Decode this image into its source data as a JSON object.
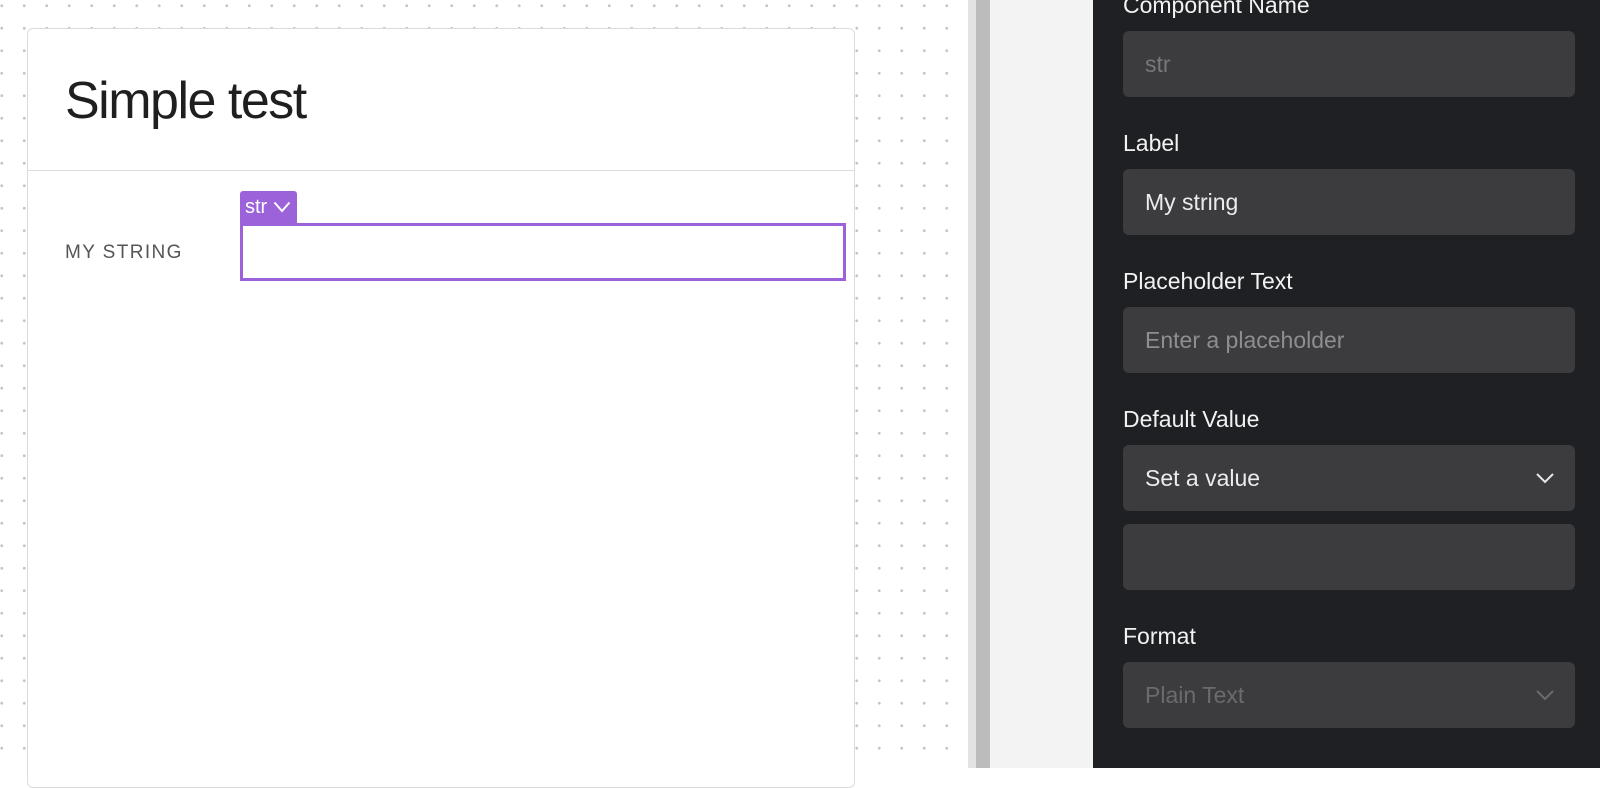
{
  "form": {
    "title": "Simple test",
    "field": {
      "label": "MY STRING",
      "tag": "str",
      "value": ""
    }
  },
  "panel": {
    "component_name": {
      "label": "Component Name",
      "value": "str"
    },
    "label": {
      "label": "Label",
      "value": "My string"
    },
    "placeholder": {
      "label": "Placeholder Text",
      "placeholder": "Enter a placeholder",
      "value": ""
    },
    "default_value": {
      "label": "Default Value",
      "selected": "Set a value",
      "value": ""
    },
    "format": {
      "label": "Format",
      "selected": "Plain Text"
    }
  },
  "icons": {
    "tag_chevron": "chevron-down-icon",
    "default_value_chevron": "chevron-down-icon",
    "format_chevron": "chevron-down-icon"
  },
  "colors": {
    "accent": "#9b62d9",
    "panel_bg": "#1f2023",
    "panel_field_bg": "#3c3c3f"
  }
}
